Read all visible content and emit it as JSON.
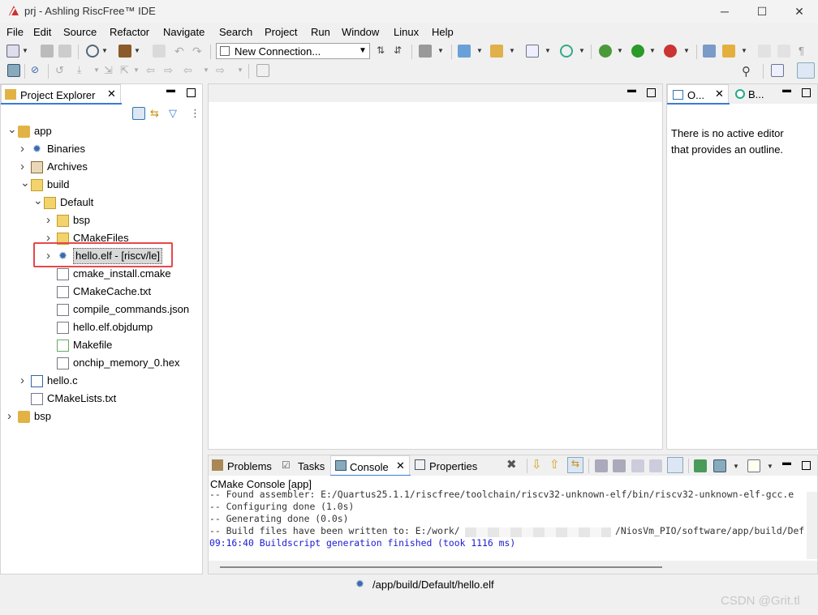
{
  "window": {
    "title": "prj - Ashling RiscFree™ IDE",
    "controls": {
      "minimize": "─",
      "maximize": "☐",
      "close": "✕"
    }
  },
  "menu": [
    "File",
    "Edit",
    "Source",
    "Refactor",
    "Navigate",
    "Search",
    "Project",
    "Run",
    "Window",
    "Linux",
    "Help"
  ],
  "toolbar": {
    "connection_label": "New Connection..."
  },
  "explorer": {
    "tab_label": "Project Explorer",
    "tree": [
      {
        "label": "app",
        "icon": "project-folder-icon",
        "level": 0,
        "expanded": true
      },
      {
        "label": "Binaries",
        "icon": "binaries-icon",
        "level": 1,
        "expanded": false
      },
      {
        "label": "Archives",
        "icon": "archives-icon",
        "level": 1,
        "expanded": false
      },
      {
        "label": "build",
        "icon": "folder-icon",
        "level": 1,
        "expanded": true
      },
      {
        "label": "Default",
        "icon": "folder-icon",
        "level": 2,
        "expanded": true
      },
      {
        "label": "bsp",
        "icon": "folder-icon",
        "level": 3,
        "expanded": false
      },
      {
        "label": "CMakeFiles",
        "icon": "folder-icon",
        "level": 3,
        "expanded": false
      },
      {
        "label": "hello.elf - [riscv/le]",
        "icon": "elf-binary-icon",
        "level": 3,
        "expanded": false,
        "selected": true
      },
      {
        "label": "cmake_install.cmake",
        "icon": "file-icon",
        "level": 3
      },
      {
        "label": "CMakeCache.txt",
        "icon": "file-icon",
        "level": 3
      },
      {
        "label": "compile_commands.json",
        "icon": "file-icon",
        "level": 3
      },
      {
        "label": "hello.elf.objdump",
        "icon": "file-icon",
        "level": 3
      },
      {
        "label": "Makefile",
        "icon": "makefile-icon",
        "level": 3
      },
      {
        "label": "onchip_memory_0.hex",
        "icon": "file-icon",
        "level": 3
      },
      {
        "label": "hello.c",
        "icon": "c-source-icon",
        "level": 1,
        "expanded": false
      },
      {
        "label": "CMakeLists.txt",
        "icon": "file-icon",
        "level": 1
      },
      {
        "label": "bsp",
        "icon": "project-folder-icon",
        "level": 0,
        "expanded": false
      }
    ]
  },
  "outline": {
    "tab1": "O...",
    "tab2": "B...",
    "message_line1": "There is no active editor",
    "message_line2": "that provides an outline."
  },
  "bottom": {
    "tabs": [
      "Problems",
      "Tasks",
      "Console",
      "Properties"
    ],
    "console_title": "CMake Console [app]",
    "console_lines": [
      "-- Found assembler: E:/Quartus25.1.1/riscfree/toolchain/riscv32-unknown-elf/bin/riscv32-unknown-elf-gcc.e",
      "-- Configuring done (1.0s)",
      "-- Generating done (0.0s)",
      "-- Build files have been written to: E:/work/",
      "09:16:40 Buildscript generation finished (took 1116 ms)"
    ],
    "console_line4_tail": "/NiosVm_PIO/software/app/build/Def"
  },
  "status": {
    "path": "/app/build/Default/hello.elf"
  },
  "watermark": "CSDN @Grit.tl",
  "colors": {
    "highlight": "#e8474b",
    "console_info": "#1a1ad6"
  }
}
